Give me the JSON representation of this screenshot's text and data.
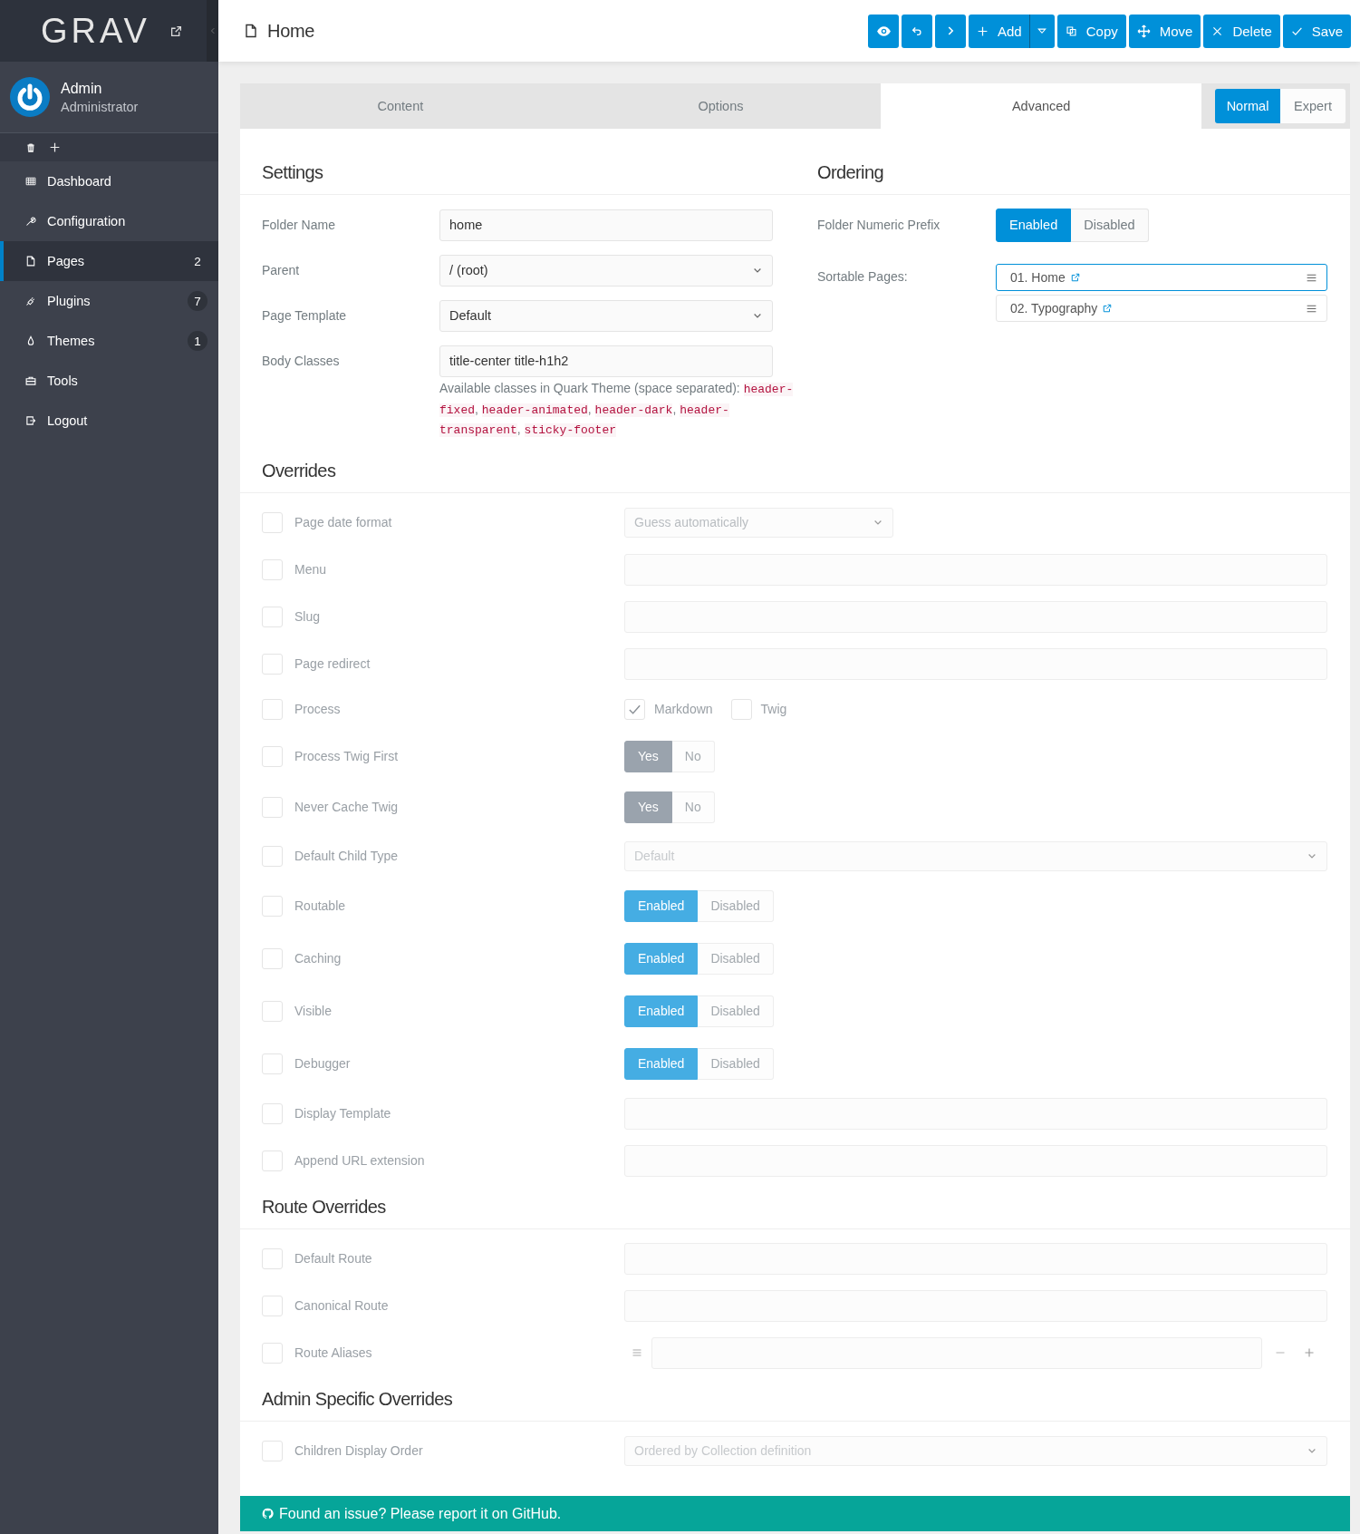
{
  "sidebar": {
    "logo": "GRAV",
    "user": {
      "name": "Admin",
      "role": "Administrator"
    },
    "nav": [
      {
        "label": "Dashboard",
        "selected": false
      },
      {
        "label": "Configuration",
        "selected": false
      },
      {
        "label": "Pages",
        "badge": "2",
        "selected": true
      },
      {
        "label": "Plugins",
        "badge": "7",
        "selected": false
      },
      {
        "label": "Themes",
        "badge": "1",
        "selected": false
      },
      {
        "label": "Tools",
        "selected": false
      },
      {
        "label": "Logout",
        "selected": false
      }
    ]
  },
  "header": {
    "title": "Home",
    "buttons": [
      {
        "kind": "icon"
      },
      {
        "kind": "icon"
      },
      {
        "kind": "icon"
      },
      {
        "kind": "split",
        "label": "Add"
      },
      {
        "kind": "text",
        "label": "Copy"
      },
      {
        "kind": "text",
        "label": "Move"
      },
      {
        "kind": "text",
        "label": "Delete"
      },
      {
        "kind": "text",
        "label": "Save"
      }
    ]
  },
  "tabs": [
    {
      "label": "Content",
      "selected": false
    },
    {
      "label": "Options",
      "selected": false
    },
    {
      "label": "Advanced",
      "selected": true
    }
  ],
  "mode": [
    {
      "label": "Normal",
      "selected": true
    },
    {
      "label": "Expert",
      "selected": false
    }
  ],
  "settings": {
    "title": "Settings",
    "fields": [
      {
        "kind": "text",
        "label": "Folder Name",
        "value": "home"
      },
      {
        "kind": "select",
        "label": "Parent",
        "value": "/ (root)"
      },
      {
        "kind": "select",
        "label": "Page Template",
        "value": "Default"
      },
      {
        "kind": "text",
        "label": "Body Classes",
        "value": "title-center title-h1h2",
        "help": "Available classes in Quark Theme (space separated):",
        "classes": [
          {
            "name": "header-fixed",
            "sep": ","
          },
          {
            "name": "header-animated",
            "sep": ","
          },
          {
            "name": "header-dark",
            "sep": ","
          },
          {
            "name": "header-transparent",
            "sep": ","
          },
          {
            "name": "sticky-footer"
          }
        ]
      }
    ]
  },
  "ordering": {
    "title": "Ordering",
    "prefix": {
      "label": "Folder Numeric Prefix",
      "options": [
        {
          "label": "Enabled",
          "selected": true
        },
        {
          "label": "Disabled",
          "selected": false
        }
      ]
    },
    "sortable": {
      "label": "Sortable Pages:",
      "pages": [
        {
          "label": "01. Home",
          "selected": true
        },
        {
          "label": "02. Typography",
          "selected": false
        }
      ]
    }
  },
  "sections": [
    {
      "title": "Overrides",
      "rows": [
        {
          "kind": "select",
          "label": "Page date format",
          "checked": false,
          "placeholder": "Guess automatically"
        },
        {
          "kind": "text",
          "label": "Menu",
          "checked": false
        },
        {
          "kind": "text",
          "label": "Slug",
          "checked": false
        },
        {
          "kind": "text",
          "label": "Page redirect",
          "checked": false
        },
        {
          "kind": "checks",
          "label": "Process",
          "checked": false,
          "options": [
            {
              "label": "Markdown",
              "checked": true
            },
            {
              "label": "Twig",
              "checked": false
            }
          ]
        },
        {
          "kind": "switch",
          "label": "Process Twig First",
          "checked": false,
          "options": [
            {
              "label": "Yes",
              "selected": true
            },
            {
              "label": "No",
              "selected": false
            }
          ]
        },
        {
          "kind": "switch",
          "label": "Never Cache Twig",
          "checked": false,
          "options": [
            {
              "label": "Yes",
              "selected": true
            },
            {
              "label": "No",
              "selected": false
            }
          ]
        },
        {
          "kind": "wideselect",
          "label": "Default Child Type",
          "checked": false,
          "value": "Default"
        },
        {
          "kind": "toggle",
          "label": "Routable",
          "checked": false,
          "options": [
            {
              "label": "Enabled",
              "selected": true
            },
            {
              "label": "Disabled",
              "selected": false
            }
          ]
        },
        {
          "kind": "toggle",
          "label": "Caching",
          "checked": false,
          "options": [
            {
              "label": "Enabled",
              "selected": true
            },
            {
              "label": "Disabled",
              "selected": false
            }
          ]
        },
        {
          "kind": "toggle",
          "label": "Visible",
          "checked": false,
          "options": [
            {
              "label": "Enabled",
              "selected": true
            },
            {
              "label": "Disabled",
              "selected": false
            }
          ]
        },
        {
          "kind": "toggle",
          "label": "Debugger",
          "checked": false,
          "options": [
            {
              "label": "Enabled",
              "selected": true
            },
            {
              "label": "Disabled",
              "selected": false
            }
          ]
        },
        {
          "kind": "text",
          "label": "Display Template",
          "checked": false
        },
        {
          "kind": "text",
          "label": "Append URL extension",
          "checked": false
        }
      ]
    },
    {
      "title": "Route Overrides",
      "rows": [
        {
          "kind": "text",
          "label": "Default Route",
          "checked": false
        },
        {
          "kind": "text",
          "label": "Canonical Route",
          "checked": false
        },
        {
          "kind": "list",
          "label": "Route Aliases",
          "checked": false
        }
      ]
    },
    {
      "title": "Admin Specific Overrides",
      "rows": [
        {
          "kind": "wideselect",
          "label": "Children Display Order",
          "checked": false,
          "value": "Ordered by Collection definition"
        }
      ]
    }
  ],
  "footer": "Found an issue? Please report it on GitHub."
}
